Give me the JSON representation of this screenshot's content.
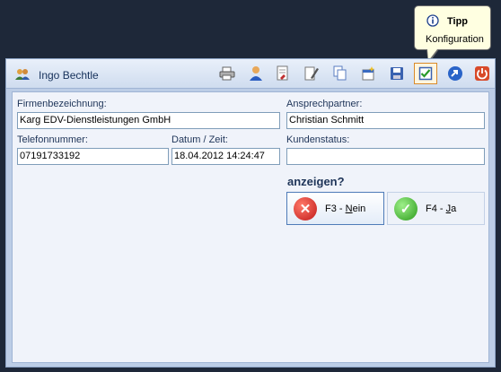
{
  "header": {
    "user_name": "Ingo Bechtle",
    "toolbar": [
      {
        "icon": "printer-icon"
      },
      {
        "icon": "person-icon"
      },
      {
        "icon": "document-edit-icon"
      },
      {
        "icon": "signature-pen-icon"
      },
      {
        "icon": "copy-icon"
      },
      {
        "icon": "new-document-icon"
      },
      {
        "icon": "save-icon"
      },
      {
        "icon": "checkbox-config-icon"
      },
      {
        "icon": "forward-arrow-icon"
      },
      {
        "icon": "power-off-icon"
      }
    ]
  },
  "tooltip": {
    "title": "Tipp",
    "text": "Konfiguration"
  },
  "form": {
    "company_label": "Firmenbezeichnung:",
    "company_value": "Karg EDV-Dienstleistungen GmbH",
    "contact_label": "Ansprechpartner:",
    "contact_value": "Christian Schmitt",
    "phone_label": "Telefonnummer:",
    "phone_value": "07191733192",
    "datetime_label": "Datum / Zeit:",
    "datetime_value": "18.04.2012 14:24:47",
    "status_label": "Kundenstatus:",
    "status_value": ""
  },
  "dialog": {
    "question": "anzeigen?",
    "no_prefix": "F3 - ",
    "no_key": "N",
    "no_rest": "ein",
    "yes_prefix": "F4 - ",
    "yes_key": "J",
    "yes_rest": "a"
  },
  "colors": {
    "background": "#1e2839",
    "window": "#bccde6",
    "panel": "#f0f3fa",
    "no_icon": "#d42a2a",
    "yes_icon": "#3cae2a",
    "tooltip_bg": "#ffffe1"
  }
}
